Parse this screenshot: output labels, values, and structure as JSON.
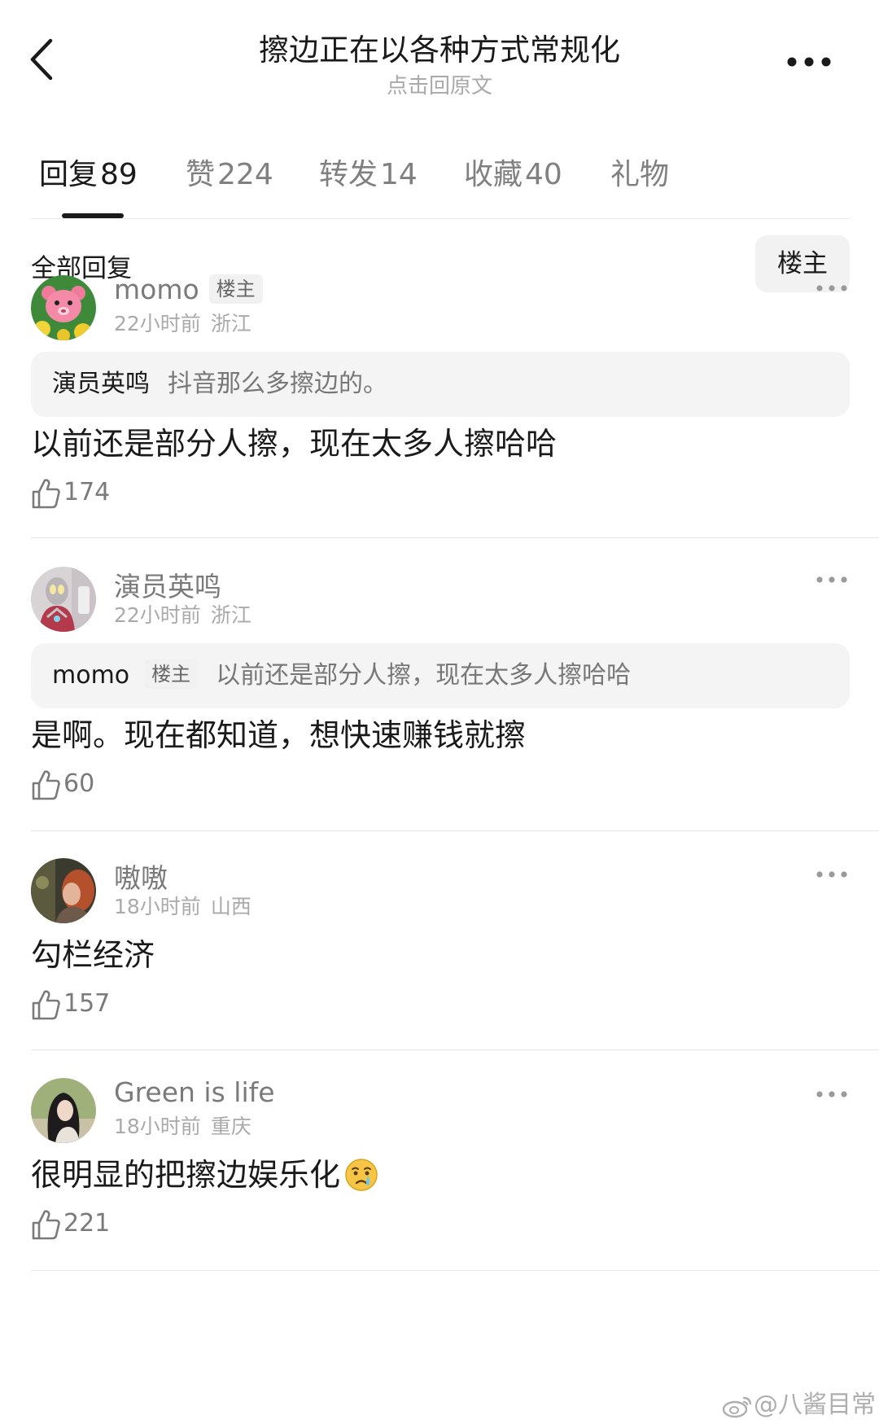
{
  "header": {
    "title": "擦边正在以各种方式常规化",
    "subtitle": "点击回原文"
  },
  "tabs": [
    {
      "label": "回复",
      "count": "89"
    },
    {
      "label": "赞",
      "count": "224"
    },
    {
      "label": "转发",
      "count": "14"
    },
    {
      "label": "收藏",
      "count": "40"
    },
    {
      "label": "礼物",
      "count": ""
    }
  ],
  "section": {
    "title": "全部回复",
    "filter_label": "楼主"
  },
  "comments": [
    {
      "username": "momo",
      "badge": "楼主",
      "time": "22小时前",
      "location": "浙江",
      "quote_user": "演员英鸣",
      "quote_text": "抖音那么多擦边的。",
      "text": "以前还是部分人擦，现在太多人擦哈哈",
      "likes": "174",
      "avatar_icon": "pink-bear-avatar"
    },
    {
      "username": "演员英鸣",
      "time": "22小时前",
      "location": "浙江",
      "quote_user": "momo",
      "quote_badge": "楼主",
      "quote_text": "以前还是部分人擦，现在太多人擦哈哈",
      "text": "是啊。现在都知道，想快速赚钱就擦",
      "likes": "60",
      "avatar_icon": "ultraman-avatar"
    },
    {
      "username": "嗷嗷",
      "time": "18小时前",
      "location": "山西",
      "text": "勾栏经济",
      "likes": "157",
      "avatar_icon": "photo-avatar"
    },
    {
      "username": "Green is life",
      "time": "18小时前",
      "location": "重庆",
      "text": "很明显的把擦边娱乐化",
      "text_emoji": "crying-face-emoji",
      "likes": "221",
      "avatar_icon": "girl-avatar"
    }
  ],
  "watermark": "@八酱目常",
  "colors": {
    "text_primary": "#1a1a1a",
    "text_secondary": "#7a7a7a",
    "text_muted": "#aaaaaa",
    "quote_bg": "#f4f4f4"
  }
}
